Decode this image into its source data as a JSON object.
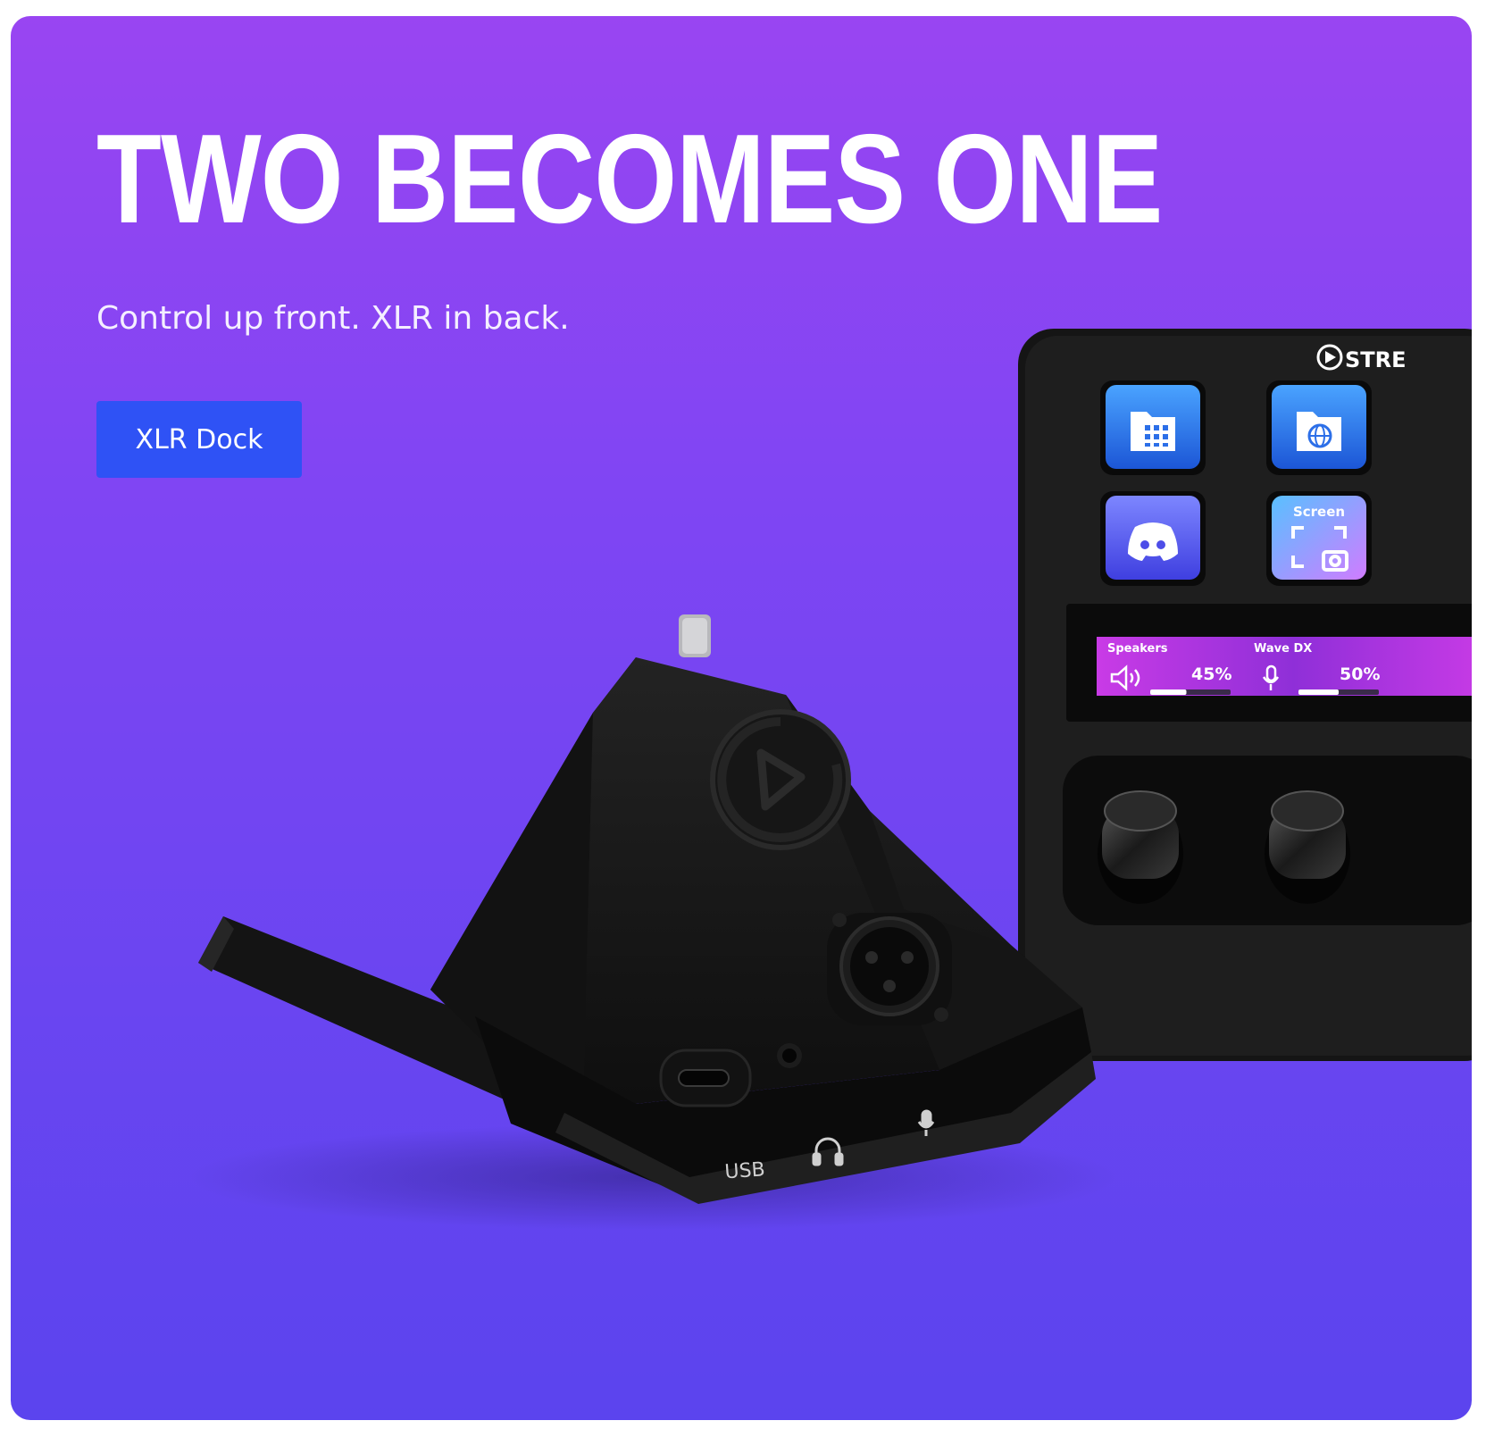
{
  "hero": {
    "title": "TWO BECOMES ONE",
    "subtitle": "Control up front. XLR in back.",
    "cta_label": "XLR Dock",
    "background_gradient": [
      "#9945f2",
      "#5b44ee"
    ],
    "button_color": "#2f52f5"
  },
  "stream_deck": {
    "brand_text": "STRE",
    "keys": [
      {
        "icon": "keypad-folder-icon"
      },
      {
        "icon": "globe-folder-icon"
      },
      {
        "icon": "discord-icon"
      },
      {
        "icon": "screenshot-icon",
        "label": "Screen"
      }
    ],
    "display": {
      "channels": [
        {
          "label": "Speakers",
          "value": "45%",
          "icon": "speaker-icon",
          "level": 0.45
        },
        {
          "label": "Wave DX",
          "value": "50%",
          "icon": "microphone-icon",
          "level": 0.5
        }
      ]
    }
  },
  "xlr_dock": {
    "port_labels": {
      "usb": "USB"
    },
    "icons": [
      "elgato-logo-icon",
      "xlr-port-icon",
      "usb-c-port-icon",
      "headphone-jack-icon",
      "headphones-icon",
      "microphone-icon"
    ]
  }
}
